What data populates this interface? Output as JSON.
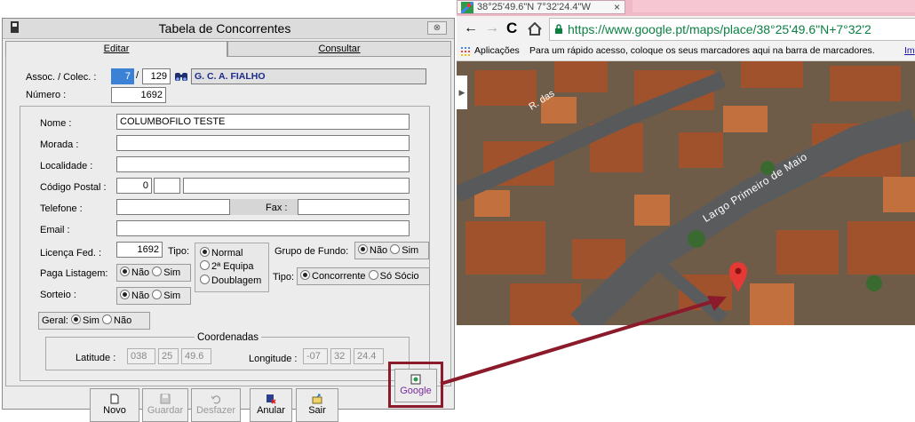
{
  "dialog": {
    "title": "Tabela de Concorrentes",
    "close_label": "⊗",
    "tabs": [
      {
        "label": "Editar",
        "active": true
      },
      {
        "label": "Consultar",
        "active": false
      }
    ],
    "assoc": {
      "label": "Assoc. / Colec. :",
      "code1": "7",
      "separator": "/",
      "code2": "129",
      "club_name": "G. C. A. FIALHO"
    },
    "numero": {
      "label": "Número :",
      "value": "1692"
    },
    "nome": {
      "label": "Nome :",
      "value": "COLUMBOFILO TESTE"
    },
    "morada": {
      "label": "Morada :",
      "value": ""
    },
    "localidade": {
      "label": "Localidade :",
      "value": ""
    },
    "codigo_postal": {
      "label": "Código Postal :",
      "value1": "0",
      "value2": "",
      "value3": ""
    },
    "telefone": {
      "label": "Telefone :",
      "value": "",
      "fax_label": "Fax :",
      "fax_value": ""
    },
    "email": {
      "label": "Email :",
      "value": ""
    },
    "licenca": {
      "label": "Licença Fed. :",
      "value": "1692"
    },
    "tipo": {
      "label": "Tipo:",
      "options": [
        "Normal",
        "2ª Equipa",
        "Doublagem"
      ],
      "selected": "Normal"
    },
    "grupo_fundo": {
      "label": "Grupo de Fundo:",
      "options": [
        "Não",
        "Sim"
      ],
      "selected": "Não"
    },
    "paga_listagem": {
      "label": "Paga Listagem:",
      "options": [
        "Não",
        "Sim"
      ],
      "selected": "Não"
    },
    "tipo2": {
      "label": "Tipo:",
      "options": [
        "Concorrente",
        "Só Sócio"
      ],
      "selected": "Concorrente"
    },
    "sorteio": {
      "label": "Sorteio :",
      "options": [
        "Não",
        "Sim"
      ],
      "selected": "Não"
    },
    "geral": {
      "label": "Geral:",
      "options": [
        "Sim",
        "Não"
      ],
      "selected": "Sim"
    },
    "coordenadas": {
      "title": "Coordenadas",
      "latitude_label": "Latitude :",
      "latitude": [
        "038",
        "25",
        "49.6"
      ],
      "longitude_label": "Longitude :",
      "longitude": [
        "-07",
        "32",
        "24.4"
      ]
    },
    "buttons": [
      {
        "label": "Novo",
        "icon": "new-document-icon",
        "enabled": true
      },
      {
        "label": "Guardar",
        "icon": "save-disk-icon",
        "enabled": false
      },
      {
        "label": "Desfazer",
        "icon": "undo-icon",
        "enabled": false
      },
      {
        "label": "Anular",
        "icon": "delete-record-icon",
        "enabled": true
      },
      {
        "label": "Sair",
        "icon": "exit-folder-icon",
        "enabled": true
      }
    ],
    "google_button": {
      "label": "Google",
      "icon": "google-maps-icon"
    }
  },
  "browser": {
    "tab_title": "38°25'49.6\"N 7°32'24.4\"W",
    "tab_close": "×",
    "url": "https://www.google.pt/maps/place/38°25'49.6\"N+7°32'2",
    "bookmarks": {
      "apps_label": "Aplicações",
      "hint": "Para um rápido acesso, coloque os seus marcadores aqui na barra de marcadores.",
      "import_link": "Im"
    },
    "map_labels": {
      "street1": "R. das",
      "street2": "Largo Primeiro de Maio"
    }
  },
  "colors": {
    "accent_red": "#8b1a2b",
    "link_blue": "#1a0dab",
    "pin_red": "#e53935",
    "url_green": "#0b8043"
  }
}
